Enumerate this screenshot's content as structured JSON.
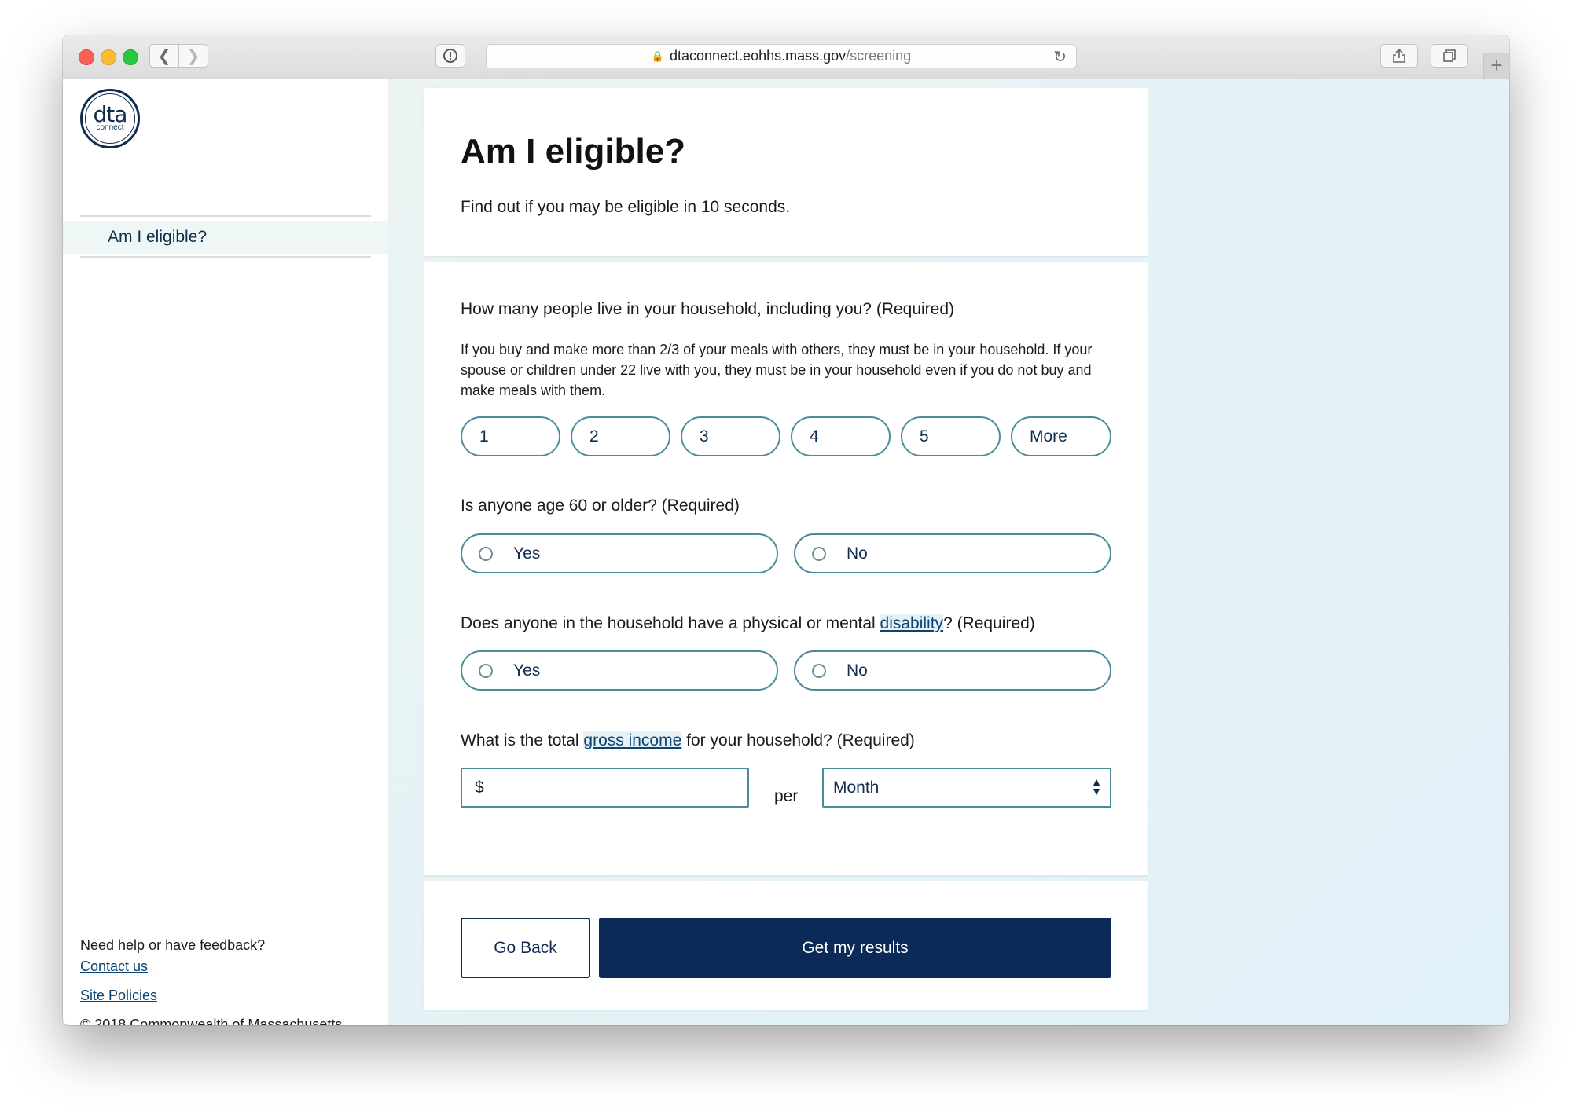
{
  "browser": {
    "url_domain": "dtaconnect.eohhs.mass.gov",
    "url_path": "/screening"
  },
  "sidebar": {
    "logo_main": "dta",
    "logo_sub": "connect",
    "nav_item": "Am I eligible?",
    "help_text": "Need help or have feedback?",
    "contact_link": "Contact us",
    "policies_link": "Site Policies",
    "copyright": "© 2018 Commonwealth of Massachusetts"
  },
  "header": {
    "title": "Am I eligible?",
    "subtitle": "Find out if you may be eligible in 10 seconds."
  },
  "household": {
    "question": "How many people live in your household, including you? (Required)",
    "hint": "If you buy and make more than 2/3 of your meals with others, they must be in your household. If your spouse or children under 22 live with you, they must be in your household even if you do not buy and make meals with them.",
    "options": [
      "1",
      "2",
      "3",
      "4",
      "5",
      "More"
    ]
  },
  "age": {
    "question": "Is anyone age 60 or older? (Required)",
    "yes": "Yes",
    "no": "No"
  },
  "disability": {
    "question_pre": "Does anyone in the household have a physical or mental ",
    "link": "disability",
    "question_post": "? (Required)",
    "yes": "Yes",
    "no": "No"
  },
  "income": {
    "question_pre": "What is the total ",
    "link": "gross income",
    "question_post": " for your household? (Required)",
    "currency": "$",
    "per": "per",
    "period": "Month"
  },
  "actions": {
    "back": "Go Back",
    "submit": "Get my results"
  },
  "colors": {
    "navy": "#0c2a57",
    "border_teal": "#4b8a99",
    "link": "#0b4473"
  }
}
